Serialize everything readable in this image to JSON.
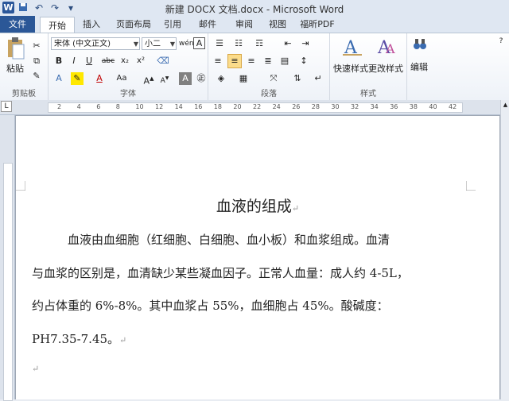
{
  "window": {
    "title": "新建 DOCX 文档.docx - Microsoft Word",
    "logo": "W"
  },
  "quick_access": {
    "icons": [
      "save-icon",
      "undo-icon",
      "redo-icon",
      "customize-icon"
    ]
  },
  "tabs": [
    {
      "label": "文件"
    },
    {
      "label": "开始"
    },
    {
      "label": "插入"
    },
    {
      "label": "页面布局"
    },
    {
      "label": "引用"
    },
    {
      "label": "邮件"
    },
    {
      "label": "审阅"
    },
    {
      "label": "视图"
    },
    {
      "label": "福昕PDF"
    }
  ],
  "ribbon": {
    "clipboard": {
      "paste_label": "粘贴",
      "group_label": "剪贴板"
    },
    "font": {
      "font_name": "宋体 (中文正文)",
      "font_size": "小二",
      "group_label": "字体"
    },
    "paragraph": {
      "group_label": "段落"
    },
    "styles": {
      "quick_styles": "快速样式",
      "change_styles": "更改样式",
      "group_label": "样式"
    },
    "editing": {
      "label": "编辑"
    }
  },
  "ruler": {
    "ticks": [
      "2",
      "4",
      "6",
      "8",
      "10",
      "12",
      "14",
      "16",
      "18",
      "20",
      "22",
      "24",
      "26",
      "28",
      "30",
      "32",
      "34",
      "36",
      "38",
      "40",
      "42"
    ]
  },
  "document": {
    "title": "血液的组成",
    "para1": "血液由血细胞（红细胞、白细胞、血小板）和血浆组成。血清",
    "para2": "与血浆的区别是，血清缺少某些凝血因子。正常人血量：成人约 4-5L，",
    "para3": "约占体重的 6%-8%。其中血浆占 55%，血细胞占 45%。酸碱度：",
    "para4": "PH7.35-7.45。"
  },
  "colors": {
    "accent": "#2b5797",
    "file_tab": "#2b5797"
  }
}
